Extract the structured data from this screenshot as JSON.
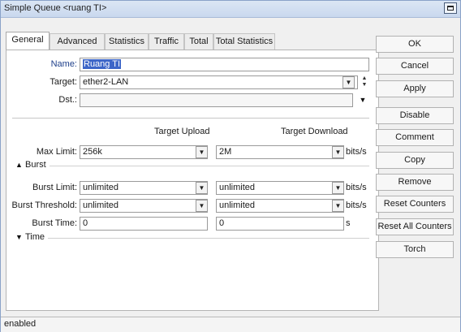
{
  "window": {
    "title": "Simple Queue <ruang TI>"
  },
  "tabs": [
    {
      "label": "General"
    },
    {
      "label": "Advanced"
    },
    {
      "label": "Statistics"
    },
    {
      "label": "Traffic"
    },
    {
      "label": "Total"
    },
    {
      "label": "Total Statistics"
    }
  ],
  "form": {
    "name_label": "Name:",
    "name_value": "Ruang TI",
    "target_label": "Target:",
    "target_value": "ether2-LAN",
    "dst_label": "Dst.:",
    "dst_value": "",
    "col_upload": "Target Upload",
    "col_download": "Target Download",
    "max_limit_label": "Max Limit:",
    "max_limit_upload": "256k",
    "max_limit_download": "2M",
    "burst_section": "Burst",
    "burst_limit_label": "Burst Limit:",
    "burst_limit_upload": "unlimited",
    "burst_limit_download": "unlimited",
    "burst_threshold_label": "Burst Threshold:",
    "burst_threshold_upload": "unlimited",
    "burst_threshold_download": "unlimited",
    "burst_time_label": "Burst Time:",
    "burst_time_upload": "0",
    "burst_time_download": "0",
    "time_section": "Time",
    "unit_bits": "bits/s",
    "unit_seconds": "s"
  },
  "buttons": {
    "ok": "OK",
    "cancel": "Cancel",
    "apply": "Apply",
    "disable": "Disable",
    "comment": "Comment",
    "copy": "Copy",
    "remove": "Remove",
    "reset_counters": "Reset Counters",
    "reset_all_counters": "Reset All Counters",
    "torch": "Torch"
  },
  "status": "enabled"
}
